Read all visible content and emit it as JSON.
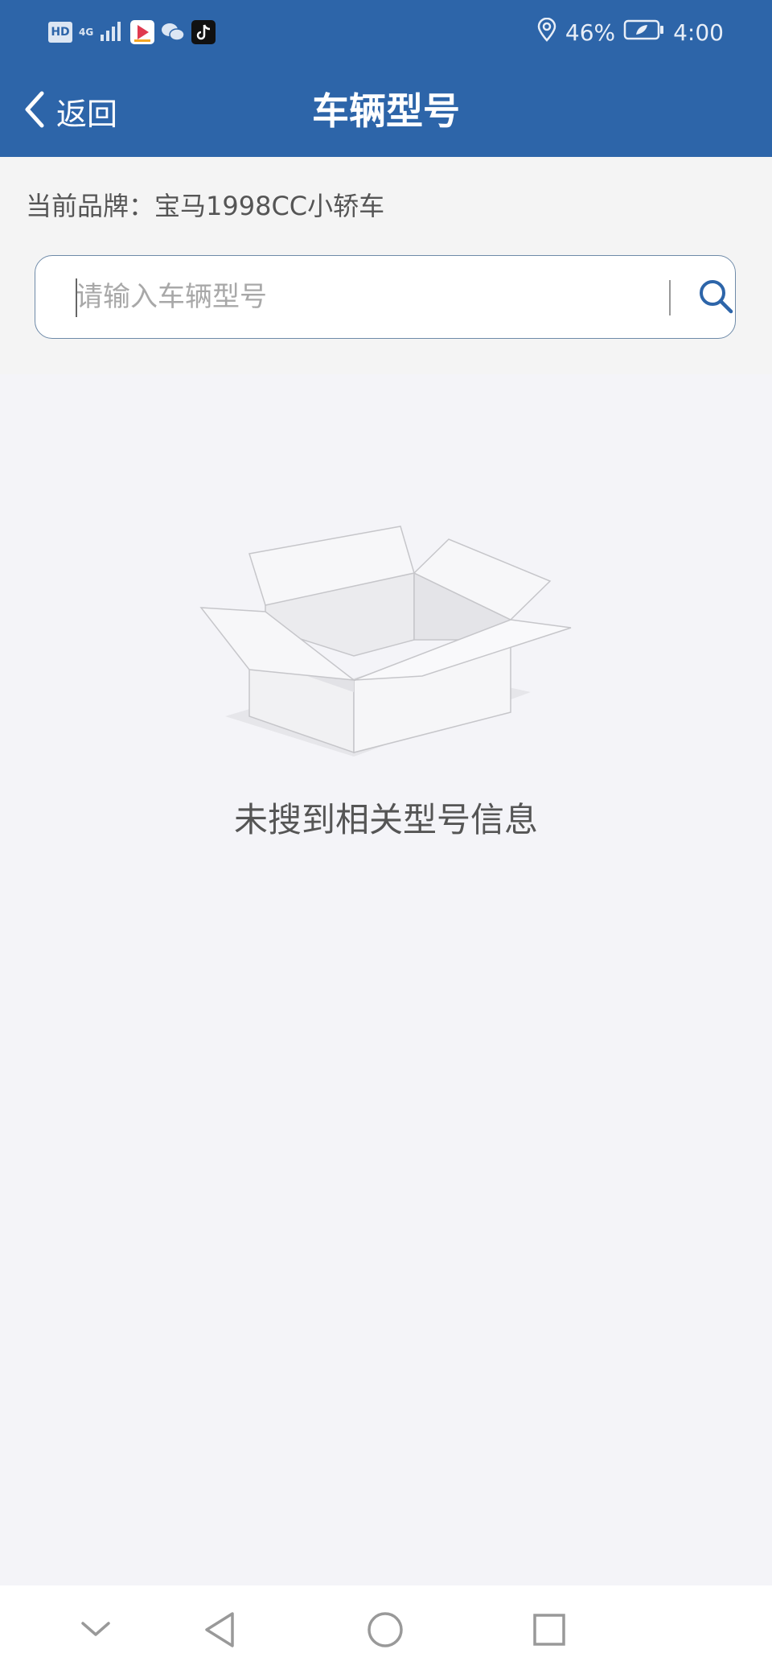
{
  "status_bar": {
    "hd": "HD",
    "network": "4G",
    "battery": "46%",
    "time": "4:00",
    "icons": [
      "hd-badge-icon",
      "signal-icon",
      "video-app-icon",
      "wechat-icon",
      "tiktok-icon",
      "location-icon",
      "battery-icon"
    ]
  },
  "header": {
    "back_label": "返回",
    "title": "车辆型号",
    "accent_color": "#2d65a9"
  },
  "brand": {
    "label": "当前品牌：",
    "value": "宝马1998CC小轿车"
  },
  "search": {
    "value": "",
    "placeholder": "请输入车辆型号"
  },
  "empty_state": {
    "message": "未搜到相关型号信息",
    "illustration": "empty-box-icon"
  },
  "nav_bar": {
    "buttons": [
      "collapse-icon",
      "back-triangle-icon",
      "home-circle-icon",
      "recents-square-icon"
    ]
  }
}
